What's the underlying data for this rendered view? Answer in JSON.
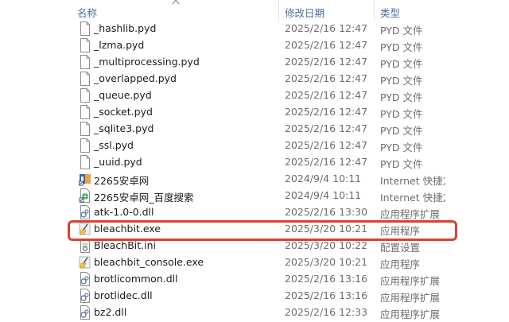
{
  "columns": {
    "name": "名称",
    "date": "修改日期",
    "type": "类型"
  },
  "highlight_color": "#d9412f",
  "files": [
    {
      "name": "_hashlib.pyd",
      "date": "2025/2/16 12:47",
      "type": "PYD 文件",
      "icon": "blank-file-icon"
    },
    {
      "name": "_lzma.pyd",
      "date": "2025/2/16 12:47",
      "type": "PYD 文件",
      "icon": "blank-file-icon"
    },
    {
      "name": "_multiprocessing.pyd",
      "date": "2025/2/16 12:47",
      "type": "PYD 文件",
      "icon": "blank-file-icon"
    },
    {
      "name": "_overlapped.pyd",
      "date": "2025/2/16 12:47",
      "type": "PYD 文件",
      "icon": "blank-file-icon"
    },
    {
      "name": "_queue.pyd",
      "date": "2025/2/16 12:47",
      "type": "PYD 文件",
      "icon": "blank-file-icon"
    },
    {
      "name": "_socket.pyd",
      "date": "2025/2/16 12:47",
      "type": "PYD 文件",
      "icon": "blank-file-icon"
    },
    {
      "name": "_sqlite3.pyd",
      "date": "2025/2/16 12:47",
      "type": "PYD 文件",
      "icon": "blank-file-icon"
    },
    {
      "name": "_ssl.pyd",
      "date": "2025/2/16 12:47",
      "type": "PYD 文件",
      "icon": "blank-file-icon"
    },
    {
      "name": "_uuid.pyd",
      "date": "2025/2/16 12:47",
      "type": "PYD 文件",
      "icon": "blank-file-icon"
    },
    {
      "name": "2265安卓网",
      "date": "2024/9/4 10:11",
      "type": "Internet 快捷方式",
      "icon": "internet-shortcut-icon"
    },
    {
      "name": "2265安卓网_百度搜索",
      "date": "2024/9/4 10:11",
      "type": "Internet 快捷方式",
      "icon": "web-shortcut-icon"
    },
    {
      "name": "atk-1.0-0.dll",
      "date": "2025/2/16 13:30",
      "type": "应用程序扩展",
      "icon": "dll-gear-icon"
    },
    {
      "name": "bleachbit.exe",
      "date": "2025/3/20 10:21",
      "type": "应用程序",
      "icon": "bleachbit-broom-icon"
    },
    {
      "name": "BleachBit.ini",
      "date": "2025/3/20 10:22",
      "type": "配置设置",
      "icon": "ini-settings-icon"
    },
    {
      "name": "bleachbit_console.exe",
      "date": "2025/3/20 10:21",
      "type": "应用程序",
      "icon": "bleachbit-broom-icon"
    },
    {
      "name": "brotlicommon.dll",
      "date": "2025/2/16 13:16",
      "type": "应用程序扩展",
      "icon": "dll-gear-icon"
    },
    {
      "name": "brotlidec.dll",
      "date": "2025/2/16 13:16",
      "type": "应用程序扩展",
      "icon": "dll-gear-icon"
    },
    {
      "name": "bz2.dll",
      "date": "2025/2/16 12:33",
      "type": "应用程序扩展",
      "icon": "dll-gear-icon"
    }
  ]
}
